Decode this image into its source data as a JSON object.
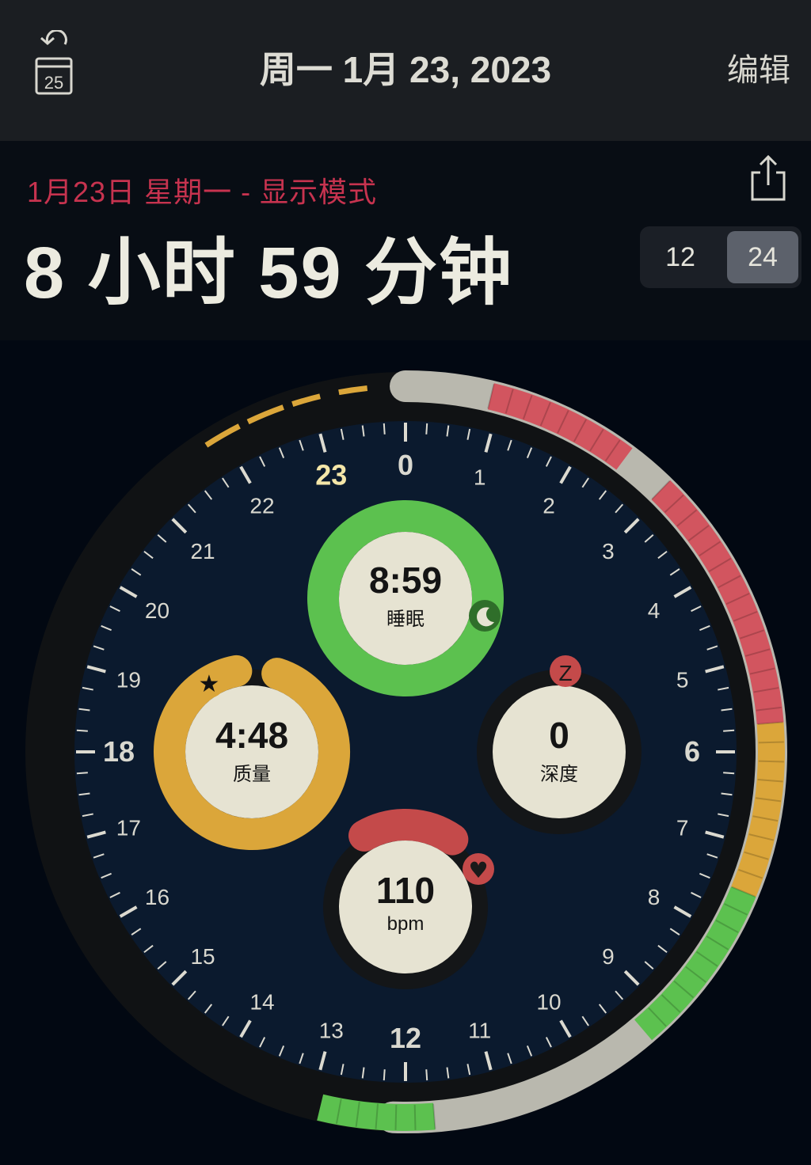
{
  "nav": {
    "title": "周一 1月 23, 2023",
    "edit_label": "编辑",
    "calendar_day": "25"
  },
  "header": {
    "subtitle": "1月23日 星期一 - 显示模式",
    "duration": "8 小时 59 分钟",
    "mode_options": [
      "12",
      "24"
    ],
    "selected_mode": "24"
  },
  "dial": {
    "hour_labels": [
      "0",
      "1",
      "2",
      "3",
      "4",
      "5",
      "6",
      "7",
      "8",
      "9",
      "10",
      "11",
      "12",
      "13",
      "14",
      "15",
      "16",
      "17",
      "18",
      "19",
      "20",
      "21",
      "22",
      "23"
    ],
    "bold_hours": [
      "0",
      "6",
      "12",
      "18"
    ],
    "highlight_hour": "23",
    "rings": {
      "sleep": {
        "value": "8:59",
        "label": "睡眠",
        "icon": "moon-icon",
        "color": "#5cc14f",
        "fill": 1.0
      },
      "quality": {
        "value": "4:48",
        "label": "质量",
        "icon": "star-icon",
        "color": "#dba63a",
        "fill": 0.92
      },
      "deep": {
        "value": "0",
        "label": "深度",
        "icon": "z-icon",
        "color": "#c44a4a",
        "fill": 0.0
      },
      "heart": {
        "value": "110",
        "label": "bpm",
        "icon": "heart-icon",
        "color": "#c44a4a",
        "fill": 0.18
      }
    },
    "colors": {
      "face": "#0b1a2e",
      "track": "#b9b8ae",
      "wake": "#d2555f",
      "light": "#dba63a",
      "deep": "#5cc14f",
      "pre_sleep": "#dba63a"
    }
  }
}
